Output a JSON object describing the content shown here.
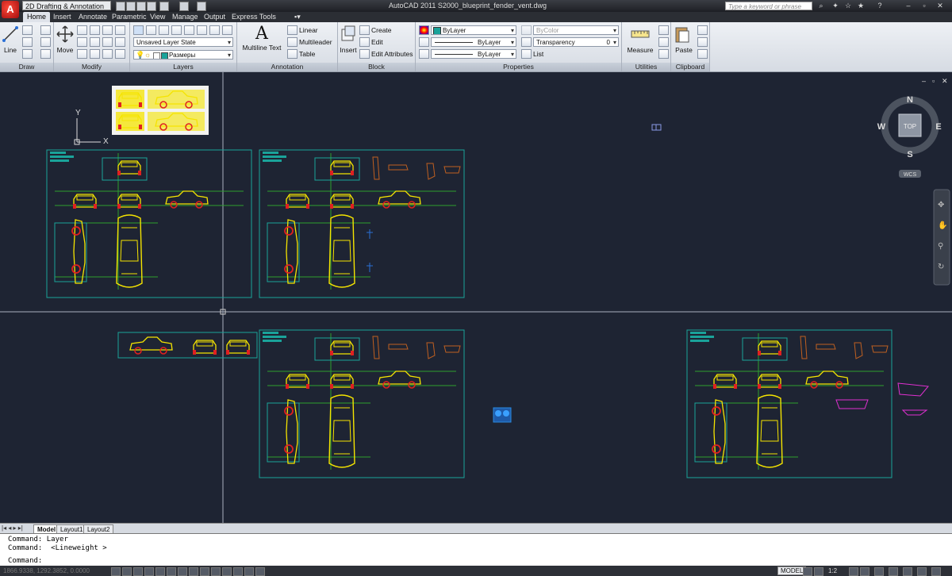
{
  "title_bar": {
    "workspace": "2D Drafting & Annotation",
    "app_title": "AutoCAD 2011   S2000_blueprint_fender_vent.dwg",
    "search_placeholder": "Type a keyword or phrase"
  },
  "tabs": [
    "Home",
    "Insert",
    "Annotate",
    "Parametric",
    "View",
    "Manage",
    "Output",
    "Express Tools"
  ],
  "active_tab": "Home",
  "ribbon": {
    "draw": {
      "title": "Draw",
      "line_label": "Line"
    },
    "modify": {
      "title": "Modify",
      "move_label": "Move"
    },
    "layers": {
      "title": "Layers",
      "layer_state": "Unsaved Layer State",
      "current_layer": "Размеры"
    },
    "annotation": {
      "title": "Annotation",
      "multiline_text": "Multiline Text",
      "linear": "Linear",
      "multileader": "Multileader",
      "table": "Table"
    },
    "block": {
      "title": "Block",
      "insert": "Insert",
      "create": "Create",
      "edit": "Edit",
      "edit_attributes": "Edit Attributes"
    },
    "properties": {
      "title": "Properties",
      "color": "ByLayer",
      "linetype": "ByLayer",
      "lineweight": "ByLayer",
      "plot_style": "ByColor",
      "transparency_label": "Transparency",
      "transparency_value": "0",
      "list": "List"
    },
    "utilities": {
      "title": "Utilities",
      "measure": "Measure"
    },
    "clipboard": {
      "title": "Clipboard",
      "paste": "Paste"
    }
  },
  "viewcube": {
    "n": "N",
    "s": "S",
    "e": "E",
    "w": "W",
    "face": "TOP",
    "ucs": "WCS"
  },
  "ucs_icon": {
    "y_label": "Y",
    "x_label": "X"
  },
  "layout_tabs": [
    "Model",
    "Layout1",
    "Layout2"
  ],
  "command_lines": [
    "Command: Layer",
    "Command:  <Lineweight >",
    "Command:"
  ],
  "status_bar": {
    "coords": "1866.9338, 1292.3852, 0.0000",
    "model": "MODEL",
    "scale": "1:2"
  },
  "colors": {
    "canvas": "#1e2433",
    "frame": "#1aa39a",
    "car_outline": "#f5e400",
    "wheel_red": "#e02020",
    "guide_green": "#2ea02e",
    "orange_part": "#c06020",
    "magenta": "#e030d0"
  }
}
